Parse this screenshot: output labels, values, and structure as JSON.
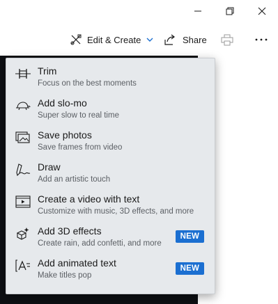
{
  "window_controls": {
    "minimize_icon": "minimize-icon",
    "maximize_icon": "restore-icon",
    "close_icon": "close-icon"
  },
  "toolbar": {
    "edit_create_label": "Edit & Create",
    "share_label": "Share",
    "print_icon": "print-icon",
    "more_icon": "more-icon"
  },
  "menu": {
    "items": [
      {
        "icon": "trim-icon",
        "title": "Trim",
        "subtitle": "Focus on the best moments",
        "badge": ""
      },
      {
        "icon": "turtle-icon",
        "title": "Add slo-mo",
        "subtitle": "Super slow to real time",
        "badge": ""
      },
      {
        "icon": "save-photos-icon",
        "title": "Save photos",
        "subtitle": "Save frames from video",
        "badge": ""
      },
      {
        "icon": "draw-icon",
        "title": "Draw",
        "subtitle": "Add an artistic touch",
        "badge": ""
      },
      {
        "icon": "video-text-icon",
        "title": "Create a video with text",
        "subtitle": "Customize with music, 3D effects, and more",
        "badge": ""
      },
      {
        "icon": "3d-effects-icon",
        "title": "Add 3D effects",
        "subtitle": "Create rain, add confetti, and more",
        "badge": "NEW"
      },
      {
        "icon": "animated-text-icon",
        "title": "Add animated text",
        "subtitle": "Make titles pop",
        "badge": "NEW"
      }
    ]
  },
  "colors": {
    "badge": "#1b6fd1",
    "flyout_bg": "#e6e9ec",
    "video_bg": "#0d0f13",
    "accent_chevron": "#1b6fd1"
  }
}
